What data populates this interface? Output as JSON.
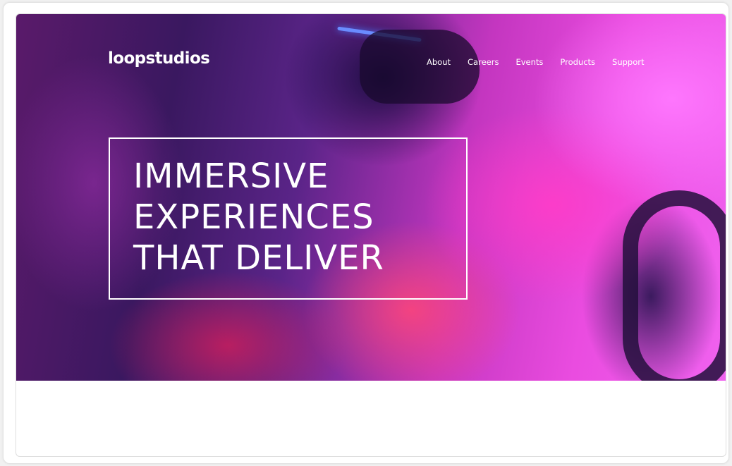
{
  "brand": {
    "logo_text": "loopstudios"
  },
  "nav": {
    "items": [
      {
        "label": "About"
      },
      {
        "label": "Careers"
      },
      {
        "label": "Events"
      },
      {
        "label": "Products"
      },
      {
        "label": "Support"
      }
    ]
  },
  "hero": {
    "headline_lines": [
      "IMMERSIVE",
      "EXPERIENCES",
      "THAT DELIVER"
    ],
    "background_image": "person-wearing-vr-headset-in-driving-simulator"
  },
  "colors": {
    "text": "#ffffff",
    "accent_magenta": "#ea4ce0",
    "accent_purple": "#5a2488",
    "page_background": "#ffffff"
  }
}
